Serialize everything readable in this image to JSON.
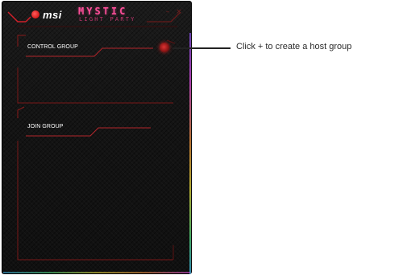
{
  "header": {
    "brand": "msi",
    "title": "MYSTIC",
    "subtitle": "LIGHT PARTY"
  },
  "window_controls": {
    "minimize": "–",
    "close": "×"
  },
  "groups": {
    "control": {
      "label": "CONTROL GROUP"
    },
    "join": {
      "label": "JOIN GROUP"
    }
  },
  "callout": {
    "text": "Click + to create a host group"
  },
  "colors": {
    "accent_red": "#e01e1e",
    "title_pink": "#ff4f9a"
  },
  "icons": {
    "logo": "msi-dragon-icon",
    "add": "plus-circle-icon"
  }
}
